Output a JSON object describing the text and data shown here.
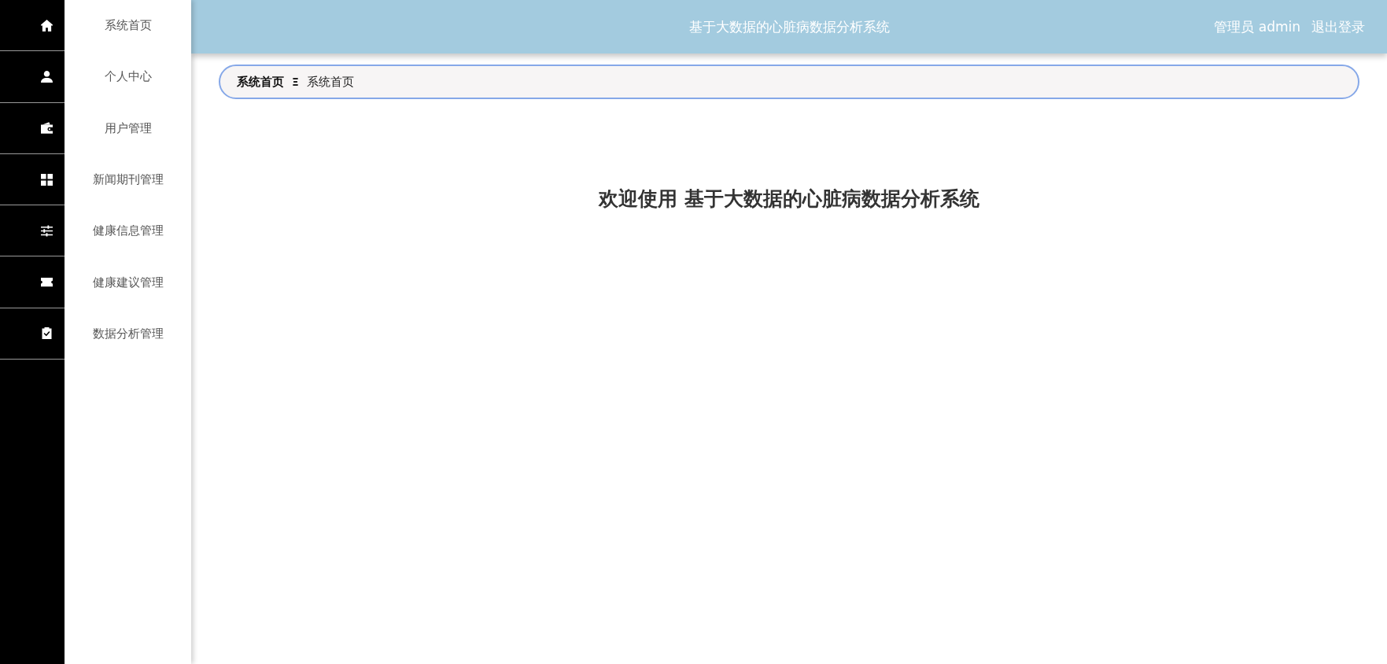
{
  "sidebar": {
    "items": [
      {
        "label": "系统首页"
      },
      {
        "label": "个人中心"
      },
      {
        "label": "用户管理"
      },
      {
        "label": "新闻期刊管理"
      },
      {
        "label": "健康信息管理"
      },
      {
        "label": "健康建议管理"
      },
      {
        "label": "数据分析管理"
      }
    ]
  },
  "header": {
    "title": "基于大数据的心脏病数据分析系统",
    "user": "管理员 admin",
    "logout": "退出登录"
  },
  "breadcrumb": {
    "separator": "Ξ",
    "items": [
      {
        "label": "系统首页",
        "current": false
      },
      {
        "label": "系统首页",
        "current": true
      }
    ]
  },
  "welcome": {
    "heading": "欢迎使用 基于大数据的心脏病数据分析系统"
  }
}
